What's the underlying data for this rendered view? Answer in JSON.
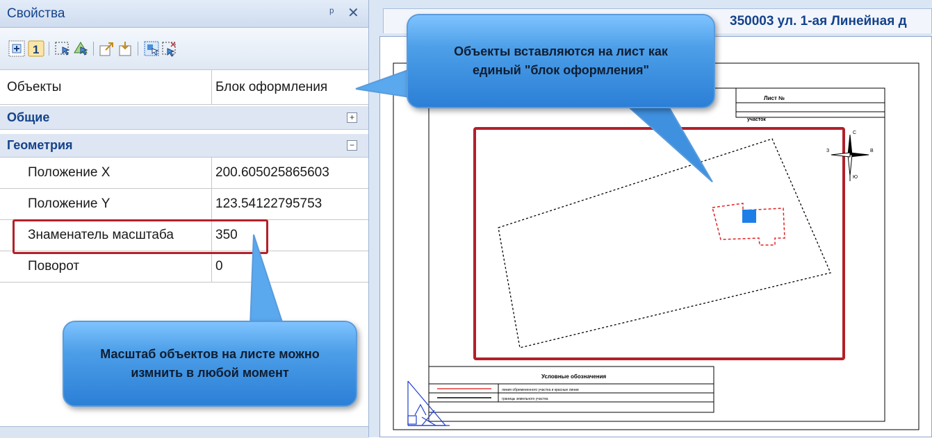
{
  "panel": {
    "title": "Свойства",
    "pin_glyph": "ᵖ",
    "close_glyph": "✕",
    "toolbar_icons": [
      "categorized-icon",
      "page-number-icon",
      "select-object-icon",
      "select-similar-icon",
      "export-icon",
      "import-icon",
      "select-region-icon",
      "deselect-icon"
    ],
    "objects_row": {
      "name": "Объекты",
      "value": "Блок оформления"
    },
    "categories": [
      {
        "label": "Общие",
        "expander": "+"
      },
      {
        "label": "Геометрия",
        "expander": "−"
      }
    ],
    "properties": [
      {
        "name": "Положение X",
        "value": "200.605025865603"
      },
      {
        "name": "Положение Y",
        "value": "123.54122795753"
      },
      {
        "name": "Знаменатель масштаба",
        "value": "350"
      },
      {
        "name": "Поворот",
        "value": "0"
      }
    ]
  },
  "document": {
    "title": "350003 ул. 1-ая Линейная д"
  },
  "sheet": {
    "stamp_title": "Лист №",
    "stamp_subtitle": "участок",
    "legend_title": "Условные обозначения",
    "legend_rows": [
      {
        "line_color": "#e53a3a",
        "text": "линия обремененного участка и красные линии"
      },
      {
        "line_color": "#000000",
        "text": "границы земельного участка"
      }
    ],
    "north_arrow_letters": [
      "С",
      "З",
      "В",
      "Ю"
    ]
  },
  "callouts": {
    "top": "Объекты вставляются на лист как единый \"блок оформления\"",
    "bottom": "Масштаб объектов на листе можно измнить в любой момент"
  },
  "colors": {
    "highlight": "#b2202a",
    "callout": "#4d9fe8",
    "title_text": "#15428b",
    "marker": "#1e7ee8"
  }
}
